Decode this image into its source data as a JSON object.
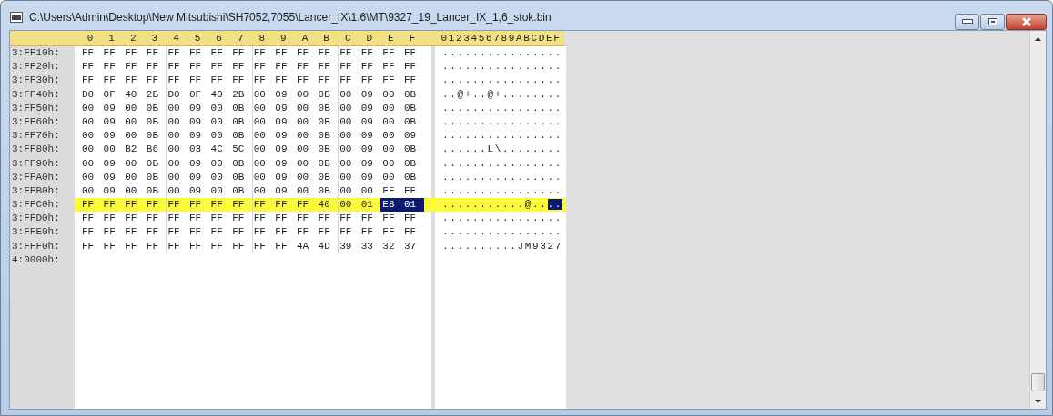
{
  "window": {
    "title": "C:\\Users\\Admin\\Desktop\\New Mitsubishi\\SH7052,7055\\Lancer_IX\\1.6\\MT\\9327_19_Lancer_IX_1,6_stok.bin"
  },
  "header": {
    "hex_columns": [
      "0",
      "1",
      "2",
      "3",
      "4",
      "5",
      "6",
      "7",
      "8",
      "9",
      "A",
      "B",
      "C",
      "D",
      "E",
      "F"
    ],
    "ascii_columns": "0123456789ABCDEF"
  },
  "rows": [
    {
      "address": "3:FF10h:",
      "highlighted": false,
      "bytes": [
        {
          "value": "FF",
          "selected": false
        },
        {
          "value": "FF",
          "selected": false
        },
        {
          "value": "FF",
          "selected": false
        },
        {
          "value": "FF",
          "selected": false
        },
        {
          "value": "FF",
          "selected": false
        },
        {
          "value": "FF",
          "selected": false
        },
        {
          "value": "FF",
          "selected": false
        },
        {
          "value": "FF",
          "selected": false
        },
        {
          "value": "FF",
          "selected": false
        },
        {
          "value": "FF",
          "selected": false
        },
        {
          "value": "FF",
          "selected": false
        },
        {
          "value": "FF",
          "selected": false
        },
        {
          "value": "FF",
          "selected": false
        },
        {
          "value": "FF",
          "selected": false
        },
        {
          "value": "FF",
          "selected": false
        },
        {
          "value": "FF",
          "selected": false
        }
      ],
      "ascii": [
        {
          "text": "................",
          "selected": false
        }
      ]
    },
    {
      "address": "3:FF20h:",
      "highlighted": false,
      "bytes": [
        {
          "value": "FF",
          "selected": false
        },
        {
          "value": "FF",
          "selected": false
        },
        {
          "value": "FF",
          "selected": false
        },
        {
          "value": "FF",
          "selected": false
        },
        {
          "value": "FF",
          "selected": false
        },
        {
          "value": "FF",
          "selected": false
        },
        {
          "value": "FF",
          "selected": false
        },
        {
          "value": "FF",
          "selected": false
        },
        {
          "value": "FF",
          "selected": false
        },
        {
          "value": "FF",
          "selected": false
        },
        {
          "value": "FF",
          "selected": false
        },
        {
          "value": "FF",
          "selected": false
        },
        {
          "value": "FF",
          "selected": false
        },
        {
          "value": "FF",
          "selected": false
        },
        {
          "value": "FF",
          "selected": false
        },
        {
          "value": "FF",
          "selected": false
        }
      ],
      "ascii": [
        {
          "text": "................",
          "selected": false
        }
      ]
    },
    {
      "address": "3:FF30h:",
      "highlighted": false,
      "bytes": [
        {
          "value": "FF",
          "selected": false
        },
        {
          "value": "FF",
          "selected": false
        },
        {
          "value": "FF",
          "selected": false
        },
        {
          "value": "FF",
          "selected": false
        },
        {
          "value": "FF",
          "selected": false
        },
        {
          "value": "FF",
          "selected": false
        },
        {
          "value": "FF",
          "selected": false
        },
        {
          "value": "FF",
          "selected": false
        },
        {
          "value": "FF",
          "selected": false
        },
        {
          "value": "FF",
          "selected": false
        },
        {
          "value": "FF",
          "selected": false
        },
        {
          "value": "FF",
          "selected": false
        },
        {
          "value": "FF",
          "selected": false
        },
        {
          "value": "FF",
          "selected": false
        },
        {
          "value": "FF",
          "selected": false
        },
        {
          "value": "FF",
          "selected": false
        }
      ],
      "ascii": [
        {
          "text": "................",
          "selected": false
        }
      ]
    },
    {
      "address": "3:FF40h:",
      "highlighted": false,
      "bytes": [
        {
          "value": "D0",
          "selected": false
        },
        {
          "value": "0F",
          "selected": false
        },
        {
          "value": "40",
          "selected": false
        },
        {
          "value": "2B",
          "selected": false
        },
        {
          "value": "D0",
          "selected": false
        },
        {
          "value": "0F",
          "selected": false
        },
        {
          "value": "40",
          "selected": false
        },
        {
          "value": "2B",
          "selected": false
        },
        {
          "value": "00",
          "selected": false
        },
        {
          "value": "09",
          "selected": false
        },
        {
          "value": "00",
          "selected": false
        },
        {
          "value": "0B",
          "selected": false
        },
        {
          "value": "00",
          "selected": false
        },
        {
          "value": "09",
          "selected": false
        },
        {
          "value": "00",
          "selected": false
        },
        {
          "value": "0B",
          "selected": false
        }
      ],
      "ascii": [
        {
          "text": "..@+..@+........",
          "selected": false
        }
      ]
    },
    {
      "address": "3:FF50h:",
      "highlighted": false,
      "bytes": [
        {
          "value": "00",
          "selected": false
        },
        {
          "value": "09",
          "selected": false
        },
        {
          "value": "00",
          "selected": false
        },
        {
          "value": "0B",
          "selected": false
        },
        {
          "value": "00",
          "selected": false
        },
        {
          "value": "09",
          "selected": false
        },
        {
          "value": "00",
          "selected": false
        },
        {
          "value": "0B",
          "selected": false
        },
        {
          "value": "00",
          "selected": false
        },
        {
          "value": "09",
          "selected": false
        },
        {
          "value": "00",
          "selected": false
        },
        {
          "value": "0B",
          "selected": false
        },
        {
          "value": "00",
          "selected": false
        },
        {
          "value": "09",
          "selected": false
        },
        {
          "value": "00",
          "selected": false
        },
        {
          "value": "0B",
          "selected": false
        }
      ],
      "ascii": [
        {
          "text": "................",
          "selected": false
        }
      ]
    },
    {
      "address": "3:FF60h:",
      "highlighted": false,
      "bytes": [
        {
          "value": "00",
          "selected": false
        },
        {
          "value": "09",
          "selected": false
        },
        {
          "value": "00",
          "selected": false
        },
        {
          "value": "0B",
          "selected": false
        },
        {
          "value": "00",
          "selected": false
        },
        {
          "value": "09",
          "selected": false
        },
        {
          "value": "00",
          "selected": false
        },
        {
          "value": "0B",
          "selected": false
        },
        {
          "value": "00",
          "selected": false
        },
        {
          "value": "09",
          "selected": false
        },
        {
          "value": "00",
          "selected": false
        },
        {
          "value": "0B",
          "selected": false
        },
        {
          "value": "00",
          "selected": false
        },
        {
          "value": "09",
          "selected": false
        },
        {
          "value": "00",
          "selected": false
        },
        {
          "value": "0B",
          "selected": false
        }
      ],
      "ascii": [
        {
          "text": "................",
          "selected": false
        }
      ]
    },
    {
      "address": "3:FF70h:",
      "highlighted": false,
      "bytes": [
        {
          "value": "00",
          "selected": false
        },
        {
          "value": "09",
          "selected": false
        },
        {
          "value": "00",
          "selected": false
        },
        {
          "value": "0B",
          "selected": false
        },
        {
          "value": "00",
          "selected": false
        },
        {
          "value": "09",
          "selected": false
        },
        {
          "value": "00",
          "selected": false
        },
        {
          "value": "0B",
          "selected": false
        },
        {
          "value": "00",
          "selected": false
        },
        {
          "value": "09",
          "selected": false
        },
        {
          "value": "00",
          "selected": false
        },
        {
          "value": "0B",
          "selected": false
        },
        {
          "value": "00",
          "selected": false
        },
        {
          "value": "09",
          "selected": false
        },
        {
          "value": "00",
          "selected": false
        },
        {
          "value": "09",
          "selected": false
        }
      ],
      "ascii": [
        {
          "text": "................",
          "selected": false
        }
      ]
    },
    {
      "address": "3:FF80h:",
      "highlighted": false,
      "bytes": [
        {
          "value": "00",
          "selected": false
        },
        {
          "value": "00",
          "selected": false
        },
        {
          "value": "B2",
          "selected": false
        },
        {
          "value": "B6",
          "selected": false
        },
        {
          "value": "00",
          "selected": false
        },
        {
          "value": "03",
          "selected": false
        },
        {
          "value": "4C",
          "selected": false
        },
        {
          "value": "5C",
          "selected": false
        },
        {
          "value": "00",
          "selected": false
        },
        {
          "value": "09",
          "selected": false
        },
        {
          "value": "00",
          "selected": false
        },
        {
          "value": "0B",
          "selected": false
        },
        {
          "value": "00",
          "selected": false
        },
        {
          "value": "09",
          "selected": false
        },
        {
          "value": "00",
          "selected": false
        },
        {
          "value": "0B",
          "selected": false
        }
      ],
      "ascii": [
        {
          "text": "......L\\........",
          "selected": false
        }
      ]
    },
    {
      "address": "3:FF90h:",
      "highlighted": false,
      "bytes": [
        {
          "value": "00",
          "selected": false
        },
        {
          "value": "09",
          "selected": false
        },
        {
          "value": "00",
          "selected": false
        },
        {
          "value": "0B",
          "selected": false
        },
        {
          "value": "00",
          "selected": false
        },
        {
          "value": "09",
          "selected": false
        },
        {
          "value": "00",
          "selected": false
        },
        {
          "value": "0B",
          "selected": false
        },
        {
          "value": "00",
          "selected": false
        },
        {
          "value": "09",
          "selected": false
        },
        {
          "value": "00",
          "selected": false
        },
        {
          "value": "0B",
          "selected": false
        },
        {
          "value": "00",
          "selected": false
        },
        {
          "value": "09",
          "selected": false
        },
        {
          "value": "00",
          "selected": false
        },
        {
          "value": "0B",
          "selected": false
        }
      ],
      "ascii": [
        {
          "text": "................",
          "selected": false
        }
      ]
    },
    {
      "address": "3:FFA0h:",
      "highlighted": false,
      "bytes": [
        {
          "value": "00",
          "selected": false
        },
        {
          "value": "09",
          "selected": false
        },
        {
          "value": "00",
          "selected": false
        },
        {
          "value": "0B",
          "selected": false
        },
        {
          "value": "00",
          "selected": false
        },
        {
          "value": "09",
          "selected": false
        },
        {
          "value": "00",
          "selected": false
        },
        {
          "value": "0B",
          "selected": false
        },
        {
          "value": "00",
          "selected": false
        },
        {
          "value": "09",
          "selected": false
        },
        {
          "value": "00",
          "selected": false
        },
        {
          "value": "0B",
          "selected": false
        },
        {
          "value": "00",
          "selected": false
        },
        {
          "value": "09",
          "selected": false
        },
        {
          "value": "00",
          "selected": false
        },
        {
          "value": "0B",
          "selected": false
        }
      ],
      "ascii": [
        {
          "text": "................",
          "selected": false
        }
      ]
    },
    {
      "address": "3:FFB0h:",
      "highlighted": false,
      "bytes": [
        {
          "value": "00",
          "selected": false
        },
        {
          "value": "09",
          "selected": false
        },
        {
          "value": "00",
          "selected": false
        },
        {
          "value": "0B",
          "selected": false
        },
        {
          "value": "00",
          "selected": false
        },
        {
          "value": "09",
          "selected": false
        },
        {
          "value": "00",
          "selected": false
        },
        {
          "value": "0B",
          "selected": false
        },
        {
          "value": "00",
          "selected": false
        },
        {
          "value": "09",
          "selected": false
        },
        {
          "value": "00",
          "selected": false
        },
        {
          "value": "0B",
          "selected": false
        },
        {
          "value": "00",
          "selected": false
        },
        {
          "value": "00",
          "selected": false
        },
        {
          "value": "FF",
          "selected": false
        },
        {
          "value": "FF",
          "selected": false
        }
      ],
      "ascii": [
        {
          "text": "................",
          "selected": false
        }
      ]
    },
    {
      "address": "3:FFC0h:",
      "highlighted": true,
      "bytes": [
        {
          "value": "FF",
          "selected": false
        },
        {
          "value": "FF",
          "selected": false
        },
        {
          "value": "FF",
          "selected": false
        },
        {
          "value": "FF",
          "selected": false
        },
        {
          "value": "FF",
          "selected": false
        },
        {
          "value": "FF",
          "selected": false
        },
        {
          "value": "FF",
          "selected": false
        },
        {
          "value": "FF",
          "selected": false
        },
        {
          "value": "FF",
          "selected": false
        },
        {
          "value": "FF",
          "selected": false
        },
        {
          "value": "FF",
          "selected": false
        },
        {
          "value": "40",
          "selected": false
        },
        {
          "value": "00",
          "selected": false
        },
        {
          "value": "01",
          "selected": false
        },
        {
          "value": "E8",
          "selected": true
        },
        {
          "value": "01",
          "selected": true
        }
      ],
      "ascii": [
        {
          "text": "...........@..",
          "selected": false
        },
        {
          "text": "..",
          "selected": true
        }
      ]
    },
    {
      "address": "3:FFD0h:",
      "highlighted": false,
      "bytes": [
        {
          "value": "FF",
          "selected": false
        },
        {
          "value": "FF",
          "selected": false
        },
        {
          "value": "FF",
          "selected": false
        },
        {
          "value": "FF",
          "selected": false
        },
        {
          "value": "FF",
          "selected": false
        },
        {
          "value": "FF",
          "selected": false
        },
        {
          "value": "FF",
          "selected": false
        },
        {
          "value": "FF",
          "selected": false
        },
        {
          "value": "FF",
          "selected": false
        },
        {
          "value": "FF",
          "selected": false
        },
        {
          "value": "FF",
          "selected": false
        },
        {
          "value": "FF",
          "selected": false
        },
        {
          "value": "FF",
          "selected": false
        },
        {
          "value": "FF",
          "selected": false
        },
        {
          "value": "FF",
          "selected": false
        },
        {
          "value": "FF",
          "selected": false
        }
      ],
      "ascii": [
        {
          "text": "................",
          "selected": false
        }
      ]
    },
    {
      "address": "3:FFE0h:",
      "highlighted": false,
      "bytes": [
        {
          "value": "FF",
          "selected": false
        },
        {
          "value": "FF",
          "selected": false
        },
        {
          "value": "FF",
          "selected": false
        },
        {
          "value": "FF",
          "selected": false
        },
        {
          "value": "FF",
          "selected": false
        },
        {
          "value": "FF",
          "selected": false
        },
        {
          "value": "FF",
          "selected": false
        },
        {
          "value": "FF",
          "selected": false
        },
        {
          "value": "FF",
          "selected": false
        },
        {
          "value": "FF",
          "selected": false
        },
        {
          "value": "FF",
          "selected": false
        },
        {
          "value": "FF",
          "selected": false
        },
        {
          "value": "FF",
          "selected": false
        },
        {
          "value": "FF",
          "selected": false
        },
        {
          "value": "FF",
          "selected": false
        },
        {
          "value": "FF",
          "selected": false
        }
      ],
      "ascii": [
        {
          "text": "................",
          "selected": false
        }
      ]
    },
    {
      "address": "3:FFF0h:",
      "highlighted": false,
      "bytes": [
        {
          "value": "FF",
          "selected": false
        },
        {
          "value": "FF",
          "selected": false
        },
        {
          "value": "FF",
          "selected": false
        },
        {
          "value": "FF",
          "selected": false
        },
        {
          "value": "FF",
          "selected": false
        },
        {
          "value": "FF",
          "selected": false
        },
        {
          "value": "FF",
          "selected": false
        },
        {
          "value": "FF",
          "selected": false
        },
        {
          "value": "FF",
          "selected": false
        },
        {
          "value": "FF",
          "selected": false
        },
        {
          "value": "4A",
          "selected": false
        },
        {
          "value": "4D",
          "selected": false
        },
        {
          "value": "39",
          "selected": false
        },
        {
          "value": "33",
          "selected": false
        },
        {
          "value": "32",
          "selected": false
        },
        {
          "value": "37",
          "selected": false
        }
      ],
      "ascii": [
        {
          "text": "..........JM9327",
          "selected": false
        }
      ]
    },
    {
      "address": "4:0000h:",
      "highlighted": false
    }
  ]
}
